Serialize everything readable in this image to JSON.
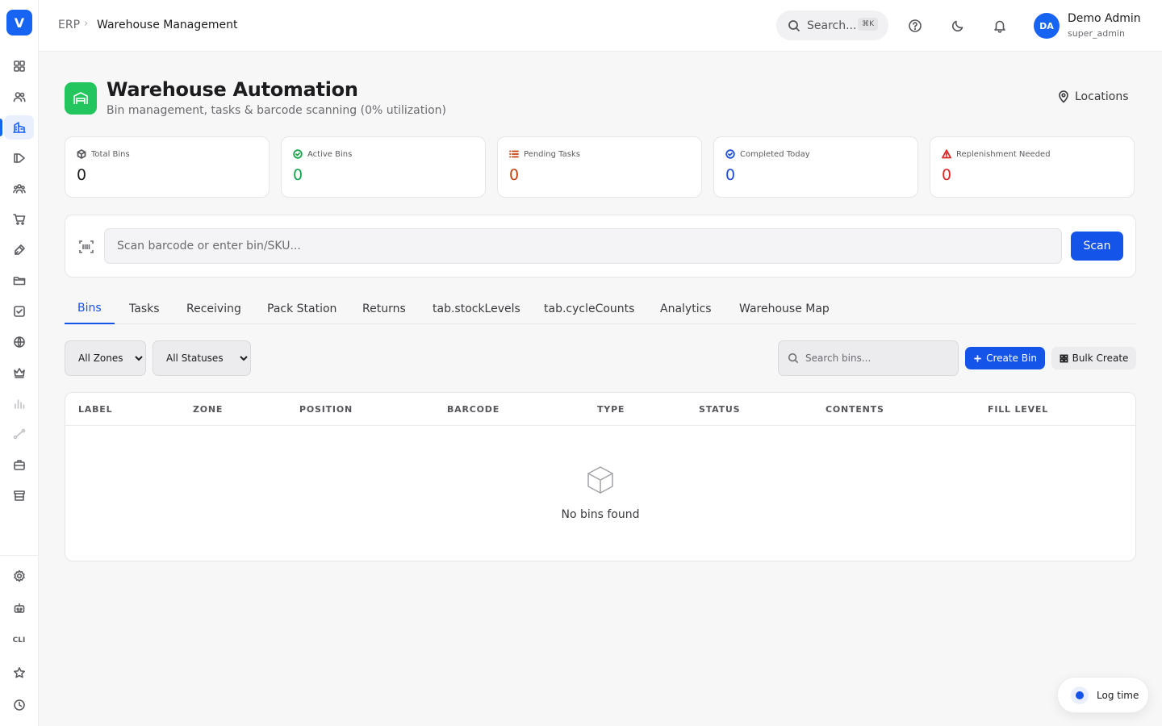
{
  "app": {
    "logo_letter": "V"
  },
  "breadcrumb": {
    "root": "ERP",
    "separator": "›",
    "current": "Warehouse Management"
  },
  "header": {
    "search_label": "Search...",
    "search_shortcut": "⌘K",
    "user": {
      "initials": "DA",
      "name": "Demo Admin",
      "role": "super_admin"
    }
  },
  "sidebar": {
    "items": [
      "dashboard-icon",
      "users-icon",
      "warehouse-icon",
      "campaign-icon",
      "team-icon",
      "cart-icon",
      "pen-icon",
      "folder-icon",
      "checkbox-icon",
      "globe-icon",
      "crown-icon",
      "bar-chart-icon",
      "route-icon",
      "briefcase-icon",
      "store-icon"
    ],
    "active": "warehouse-icon",
    "bottom_items": [
      "settings-icon",
      "robot-icon",
      "cli",
      "star-icon",
      "clock-icon"
    ],
    "cli_label": "CLI"
  },
  "page": {
    "title": "Warehouse Automation",
    "subtitle": "Bin management, tasks & barcode scanning (0% utilization)",
    "locations_label": "Locations",
    "accent_color": "#22c55e"
  },
  "stats": [
    {
      "label": "Total Bins",
      "value": "0",
      "color": "#1c1c1e"
    },
    {
      "label": "Active Bins",
      "value": "0",
      "color": "#16a34a"
    },
    {
      "label": "Pending Tasks",
      "value": "0",
      "color": "#c2410c"
    },
    {
      "label": "Completed Today",
      "value": "0",
      "color": "#1d4ed8"
    },
    {
      "label": "Replenishment Needed",
      "value": "0",
      "color": "#dc2626"
    }
  ],
  "scan": {
    "placeholder": "Scan barcode or enter bin/SKU...",
    "button_label": "Scan"
  },
  "tabs": [
    {
      "label": "Bins",
      "active": true
    },
    {
      "label": "Tasks"
    },
    {
      "label": "Receiving"
    },
    {
      "label": "Pack Station"
    },
    {
      "label": "Returns"
    },
    {
      "label": "tab.stockLevels"
    },
    {
      "label": "tab.cycleCounts"
    },
    {
      "label": "Analytics"
    },
    {
      "label": "Warehouse Map"
    }
  ],
  "filters": {
    "zone_selected": "All Zones",
    "status_selected": "All Statuses",
    "search_placeholder": "Search bins...",
    "create_label": "Create Bin",
    "bulk_label": "Bulk Create"
  },
  "table": {
    "columns": [
      "LABEL",
      "ZONE",
      "POSITION",
      "BARCODE",
      "TYPE",
      "STATUS",
      "CONTENTS",
      "FILL LEVEL"
    ],
    "empty_text": "No bins found"
  },
  "logtime": {
    "label": "Log time"
  },
  "colors": {
    "brand": "#1763f2",
    "primary_button": "#1554e8"
  }
}
